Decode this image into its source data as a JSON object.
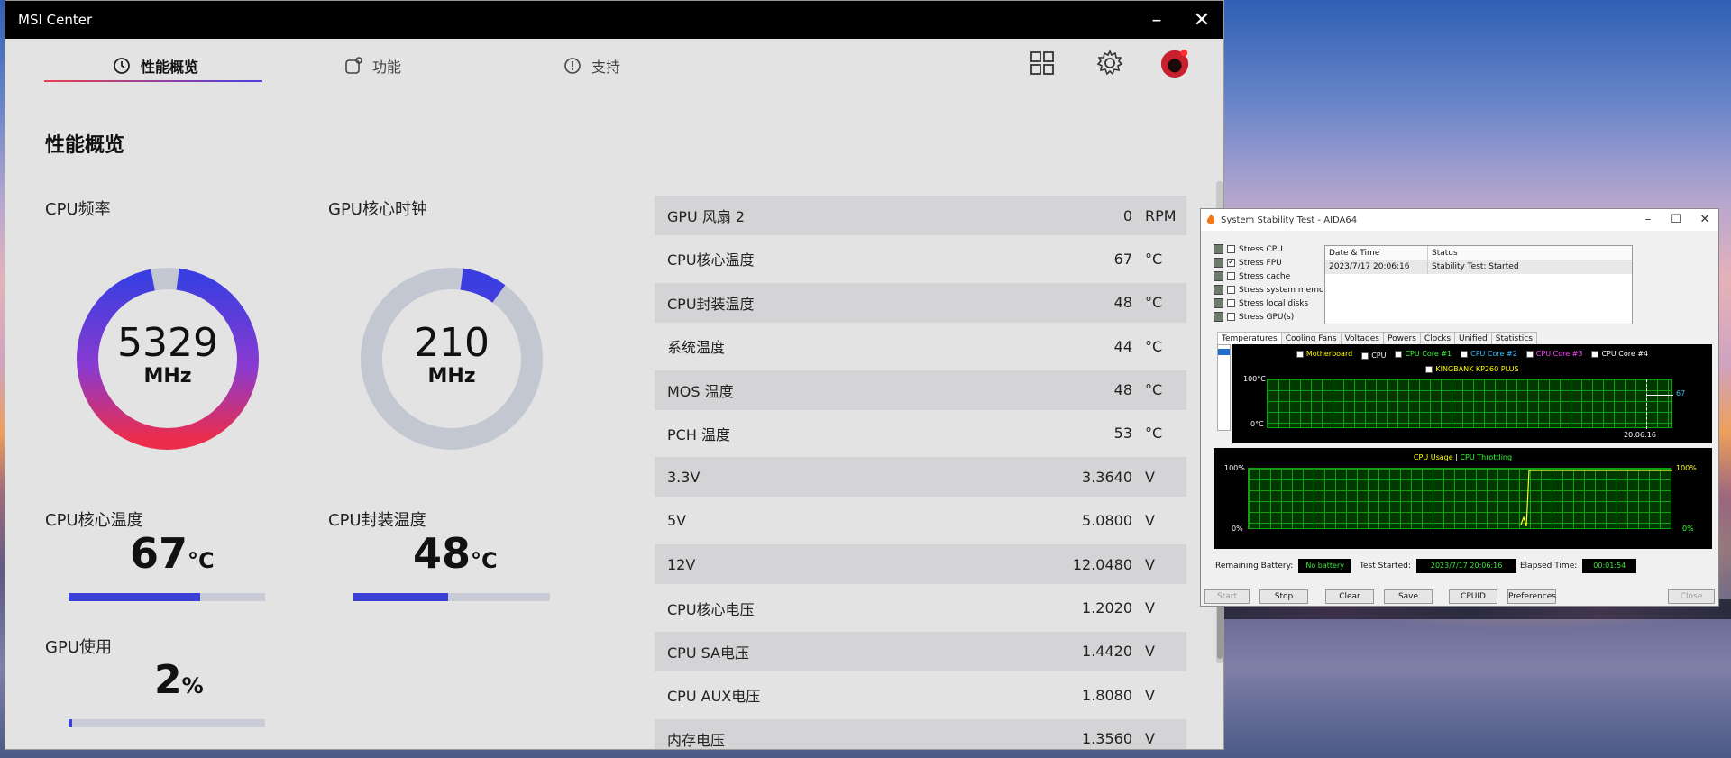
{
  "msi": {
    "window_title": "MSI Center",
    "minimize_glyph": "–",
    "close_glyph": "✕",
    "tabs": [
      {
        "label": "性能概览",
        "icon": "performance-icon",
        "active": true
      },
      {
        "label": "功能",
        "icon": "features-icon",
        "active": false
      },
      {
        "label": "支持",
        "icon": "support-icon",
        "active": false
      }
    ],
    "page_title": "性能概览",
    "cpu_freq": {
      "label": "CPU频率",
      "value": "5329",
      "unit": "MHz",
      "level": 0.95
    },
    "gpu_clock": {
      "label": "GPU核心时钟",
      "value": "210",
      "unit": "MHz",
      "level": 0.08
    },
    "cpu_core_temp": {
      "label": "CPU核心温度",
      "value": "67",
      "unit": "°C",
      "level": 0.67
    },
    "cpu_pkg_temp": {
      "label": "CPU封装温度",
      "value": "48",
      "unit": "°C",
      "level": 0.48
    },
    "gpu_usage": {
      "label": "GPU使用",
      "value": "2",
      "unit": "%",
      "level": 0.02
    },
    "sensors": [
      {
        "name": "GPU 风扇 2",
        "value": "0",
        "unit": "RPM"
      },
      {
        "name": "CPU核心温度",
        "value": "67",
        "unit": "°C"
      },
      {
        "name": "CPU封装温度",
        "value": "48",
        "unit": "°C"
      },
      {
        "name": "系统温度",
        "value": "44",
        "unit": "°C"
      },
      {
        "name": "MOS 温度",
        "value": "48",
        "unit": "°C"
      },
      {
        "name": "PCH 温度",
        "value": "53",
        "unit": "°C"
      },
      {
        "name": "3.3V",
        "value": "3.3640",
        "unit": "V"
      },
      {
        "name": "5V",
        "value": "5.0800",
        "unit": "V"
      },
      {
        "name": "12V",
        "value": "12.0480",
        "unit": "V"
      },
      {
        "name": "CPU核心电压",
        "value": "1.2020",
        "unit": "V"
      },
      {
        "name": "CPU SA电压",
        "value": "1.4420",
        "unit": "V"
      },
      {
        "name": "CPU AUX电压",
        "value": "1.8080",
        "unit": "V"
      },
      {
        "name": "内存电压",
        "value": "1.3560",
        "unit": "V"
      }
    ]
  },
  "aida": {
    "window_title": "System Stability Test - AIDA64",
    "stress_options": [
      {
        "label": "Stress CPU",
        "checked": false
      },
      {
        "label": "Stress FPU",
        "checked": true
      },
      {
        "label": "Stress cache",
        "checked": false
      },
      {
        "label": "Stress system memory",
        "checked": false
      },
      {
        "label": "Stress local disks",
        "checked": false
      },
      {
        "label": "Stress GPU(s)",
        "checked": false
      }
    ],
    "log_headers": [
      "Date & Time",
      "Status"
    ],
    "log_rows": [
      {
        "time": "2023/7/17 20:06:16",
        "status": "Stability Test: Started"
      }
    ],
    "tabs": [
      "Temperatures",
      "Cooling Fans",
      "Voltages",
      "Powers",
      "Clocks",
      "Unified",
      "Statistics"
    ],
    "temp_legend": [
      {
        "label": "Motherboard",
        "checked": false,
        "color": "#ffff00"
      },
      {
        "label": "CPU",
        "checked": true,
        "color": "#ffffff"
      },
      {
        "label": "CPU Core #1",
        "checked": false,
        "color": "#30ff30"
      },
      {
        "label": "CPU Core #2",
        "checked": false,
        "color": "#30c0ff"
      },
      {
        "label": "CPU Core #3",
        "checked": false,
        "color": "#ff40ff"
      },
      {
        "label": "CPU Core #4",
        "checked": false,
        "color": "#ffffff"
      },
      {
        "label": "KINGBANK KP260 PLUS",
        "checked": false,
        "color": "#ffff00"
      }
    ],
    "temp_graph": {
      "ymax_label": "100°C",
      "ymin_label": "0°C",
      "time_label": "20:06:16",
      "current_label": "67"
    },
    "usage_graph": {
      "title_a": "CPU Usage",
      "title_sep": "|",
      "title_b": "CPU Throttling",
      "ymax_left": "100%",
      "ymin_left": "0%",
      "ymax_right": "100%",
      "ymin_right": "0%"
    },
    "status": {
      "battery_label": "Remaining Battery:",
      "battery_value": "No battery",
      "started_label": "Test Started:",
      "started_value": "2023/7/17 20:06:16",
      "elapsed_label": "Elapsed Time:",
      "elapsed_value": "00:01:54"
    },
    "buttons": {
      "start": "Start",
      "stop": "Stop",
      "clear": "Clear",
      "save": "Save",
      "cpuid": "CPUID",
      "preferences": "Preferences",
      "close": "Close"
    }
  }
}
